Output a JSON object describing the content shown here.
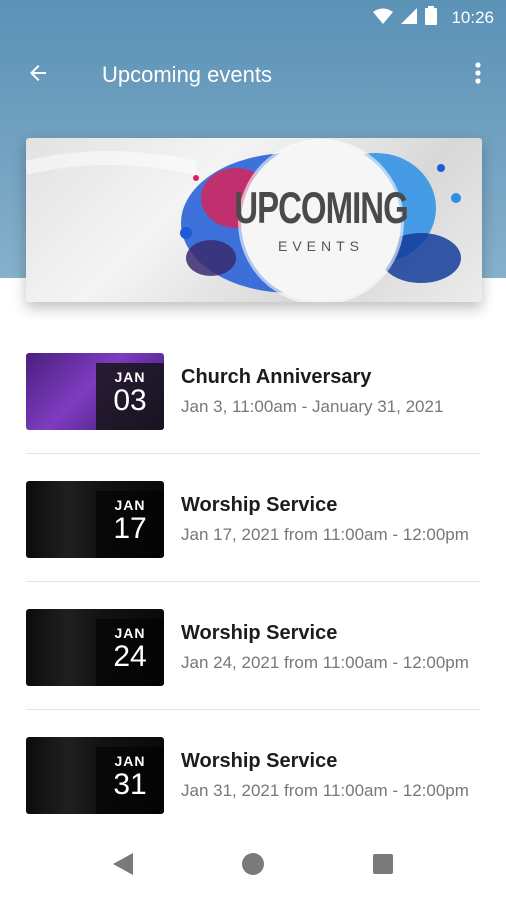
{
  "status_bar": {
    "time": "10:26",
    "icons": [
      "wifi-icon",
      "signal-icon",
      "battery-icon"
    ]
  },
  "app_bar": {
    "title": "Upcoming events",
    "back_icon": "arrow-back-icon",
    "menu_icon": "more-vert-icon"
  },
  "banner": {
    "line1": "UPCOMING",
    "line2": "EVENTS"
  },
  "events": [
    {
      "title": "Church Anniversary",
      "subtitle": "Jan 3, 11:00am - January 31, 2021",
      "month": "JAN",
      "day": "03",
      "thumb_style": "purple"
    },
    {
      "title": "Worship Service",
      "subtitle": "Jan 17, 2021 from 11:00am - 12:00pm",
      "month": "JAN",
      "day": "17",
      "thumb_style": "dark"
    },
    {
      "title": "Worship Service",
      "subtitle": "Jan 24, 2021 from 11:00am - 12:00pm",
      "month": "JAN",
      "day": "24",
      "thumb_style": "dark"
    },
    {
      "title": "Worship Service",
      "subtitle": "Jan 31, 2021 from 11:00am - 12:00pm",
      "month": "JAN",
      "day": "31",
      "thumb_style": "dark"
    }
  ],
  "nav_bar": {
    "icons": [
      "nav-back-icon",
      "nav-home-icon",
      "nav-recents-icon"
    ]
  },
  "colors": {
    "header": "#6a9cbd",
    "title_text": "#ffffff",
    "event_title": "#1c1c1c",
    "event_sub": "#777777"
  }
}
